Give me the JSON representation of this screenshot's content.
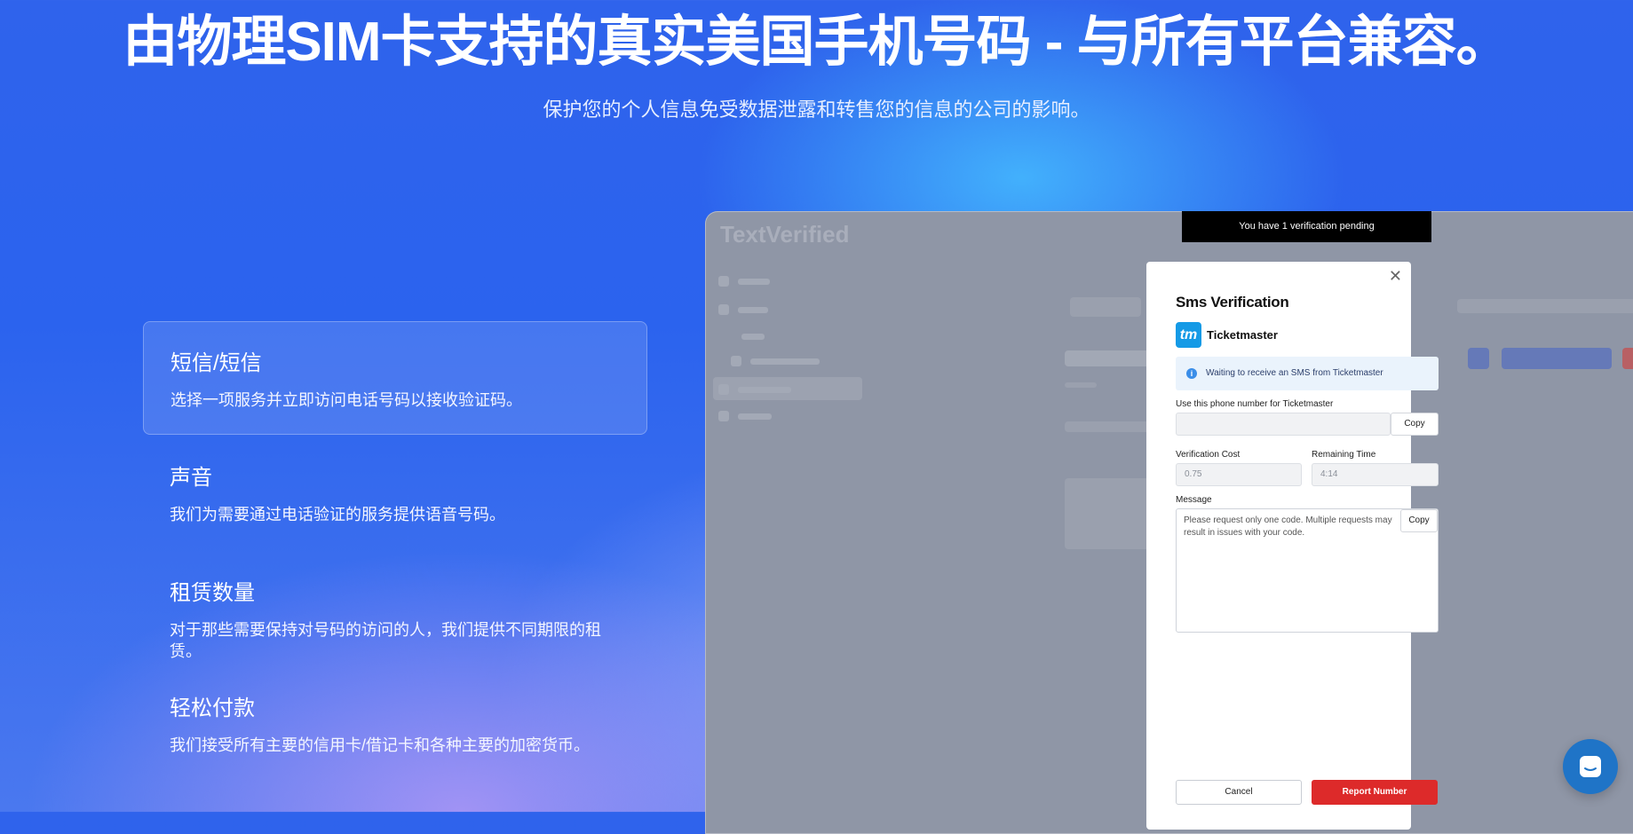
{
  "hero": {
    "title": "由物理SIM卡支持的真实美国手机号码 - 与所有平台兼容。",
    "subtitle": "保护您的个人信息免受数据泄露和转售您的信息的公司的影响。"
  },
  "features": [
    {
      "title": "短信/短信",
      "desc": "选择一项服务并立即访问电话号码以接收验证码。",
      "active": true
    },
    {
      "title": "声音",
      "desc": "我们为需要通过电话验证的服务提供语音号码。",
      "active": false
    },
    {
      "title": "租赁数量",
      "desc": "对于那些需要保持对号码的访问的人，我们提供不同期限的租赁。",
      "active": false
    },
    {
      "title": "轻松付款",
      "desc": "我们接受所有主要的信用卡/借记卡和各种主要的加密货币。",
      "active": false
    }
  ],
  "mockup": {
    "logo": "TextVerified",
    "toast": "You have 1 verification pending",
    "modal": {
      "title": "Sms Verification",
      "service_logo": "tm",
      "service_name": "Ticketmaster",
      "info": "Waiting to receive an SMS from Ticketmaster",
      "phone_label": "Use this phone number for Ticketmaster",
      "phone_value": "",
      "copy_label": "Copy",
      "cost_label": "Verification Cost",
      "cost_value": "0.75",
      "time_label": "Remaining Time",
      "time_value": "4:14",
      "message_label": "Message",
      "message_text": "Please request only one code. Multiple requests may result in issues with your code.",
      "cancel_label": "Cancel",
      "report_label": "Report Number"
    }
  },
  "colors": {
    "accent": "#2b63ee",
    "report": "#dd2a2a",
    "info_bg": "#eaf3fc",
    "chat": "#1f74c7"
  },
  "icons": [
    "close-icon",
    "info-icon",
    "chat-icon"
  ]
}
